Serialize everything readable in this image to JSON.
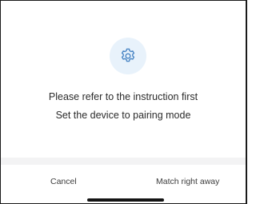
{
  "dialog": {
    "icon": "gear-icon",
    "accent_color": "#4a86c5",
    "icon_bg_color": "#e8f2fb",
    "message_line1": "Please refer to the instruction first",
    "message_line2": "Set the device to pairing mode",
    "cancel_label": "Cancel",
    "confirm_label": "Match right away"
  }
}
